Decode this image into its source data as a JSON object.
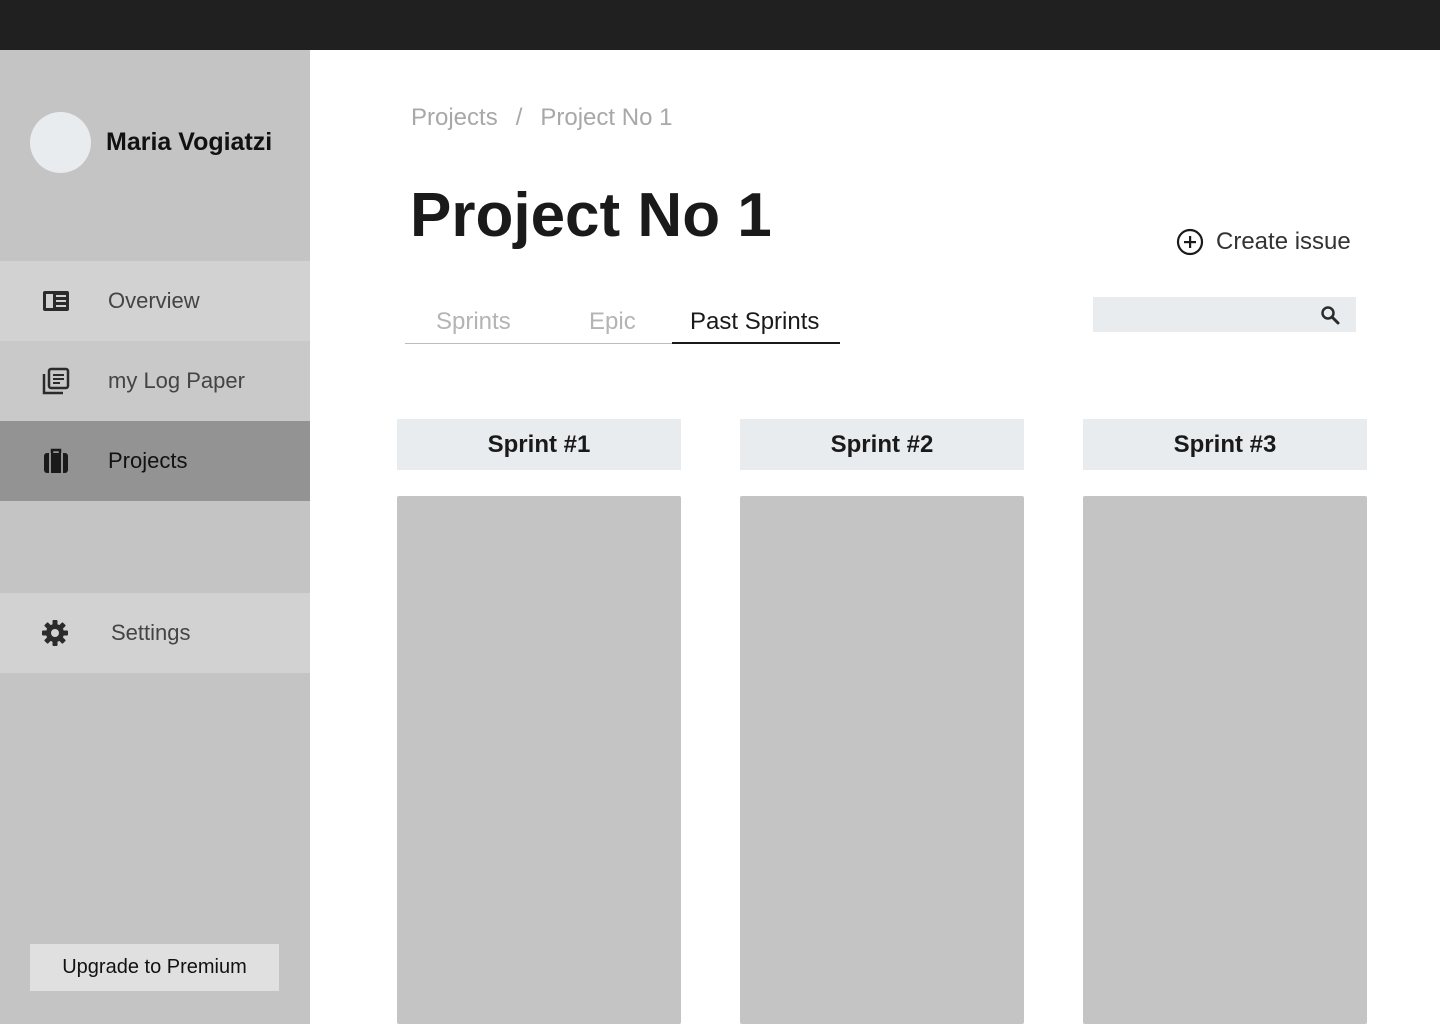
{
  "user": {
    "name": "Maria Vogiatzi"
  },
  "sidebar": {
    "items": [
      {
        "label": "Overview",
        "icon": "overview-icon"
      },
      {
        "label": "my Log Paper",
        "icon": "log-paper-icon"
      },
      {
        "label": "Projects",
        "icon": "briefcase-icon",
        "active": true
      },
      {
        "label": "Settings",
        "icon": "gear-icon"
      }
    ],
    "upgrade_label": "Upgrade to Premium"
  },
  "breadcrumb": {
    "root": "Projects",
    "separator": "/",
    "current": "Project No 1"
  },
  "page": {
    "title": "Project No 1",
    "create_issue_label": "Create issue"
  },
  "tabs": [
    {
      "label": "Sprints"
    },
    {
      "label": "Epic"
    },
    {
      "label": "Past Sprints",
      "active": true
    }
  ],
  "search": {
    "placeholder": ""
  },
  "sprints": [
    {
      "title": "Sprint #1"
    },
    {
      "title": "Sprint #2"
    },
    {
      "title": "Sprint #3"
    }
  ],
  "colors": {
    "topbar": "#202020",
    "sidebar": "#c4c4c4",
    "active_nav": "#939393",
    "sprint_header": "#e9ecef"
  }
}
